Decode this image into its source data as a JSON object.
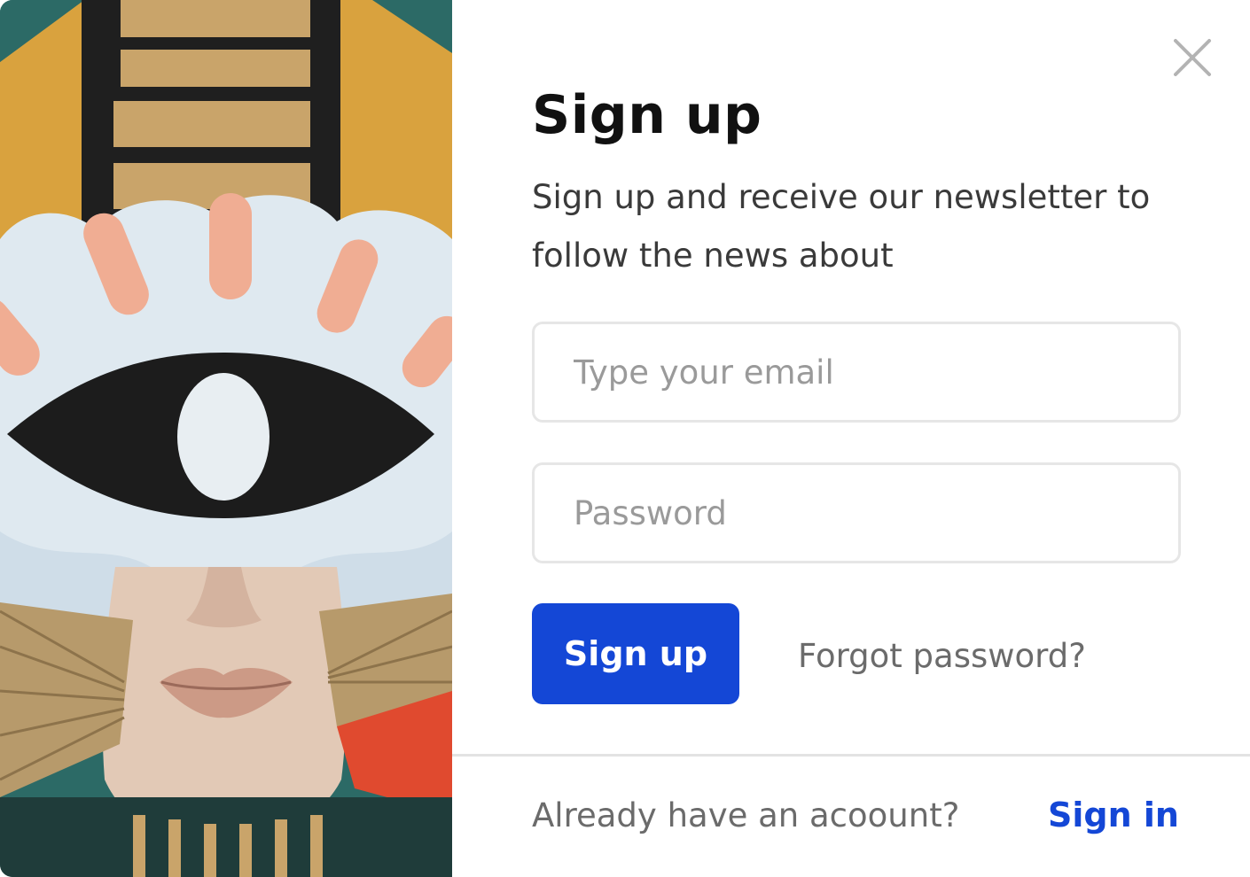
{
  "modal": {
    "title": "Sign up",
    "subtitle": "Sign up and receive our newsletter to follow the news about",
    "email": {
      "placeholder": "Type your email",
      "value": ""
    },
    "password": {
      "placeholder": "Password",
      "value": ""
    },
    "signup_button_label": "Sign up",
    "forgot_password_label": "Forgot password?",
    "footer_text": "Already have an acoount?",
    "signin_label": "Sign in",
    "close_icon": "close-icon"
  },
  "colors": {
    "accent": "#1447d6",
    "title": "#111111",
    "body_text": "#3a3a3a",
    "muted_text": "#6b6b6b",
    "border": "#e6e6e6"
  },
  "artwork": {
    "description_icon": "painted-eye-illustration"
  }
}
